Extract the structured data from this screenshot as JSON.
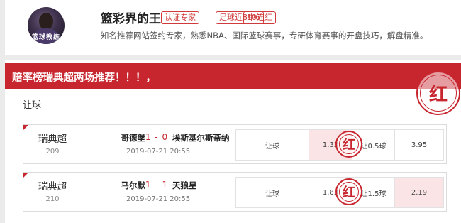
{
  "expert": {
    "name": "篮彩界的王",
    "avatar_caption": "篮球教练",
    "badges": [
      "认证专家",
      "足球近8中6",
      "10连红"
    ],
    "bio": "知名推荐网站签约专家，熟悉NBA、国际篮球赛事，专研体育赛事的开盘技巧，解盘精准。"
  },
  "article": {
    "banner_title": "赔率榜瑞典超两场推荐！！！，",
    "section_title": "让球",
    "result_stamp": "红"
  },
  "matches": [
    {
      "league": "瑞典超",
      "match_no": "209",
      "home": "哥德堡",
      "home_score": "1",
      "away_score": "0",
      "away": "埃斯基尔斯蒂纳",
      "time": "2019-07-21 20:55",
      "odds": [
        "让球",
        "1.33",
        "让0.5球",
        "3.95"
      ],
      "stamp": "红"
    },
    {
      "league": "瑞典超",
      "match_no": "210",
      "home": "马尔默",
      "home_score": "1",
      "away_score": "1",
      "away": "天狼星",
      "time": "2019-07-21 20:55",
      "odds": [
        "让球",
        "1.83",
        "让1.5球",
        "2.19"
      ],
      "stamp": "红"
    }
  ],
  "colors": {
    "accent": "#c8262f",
    "highlight_cell": "#fbe4e5"
  }
}
